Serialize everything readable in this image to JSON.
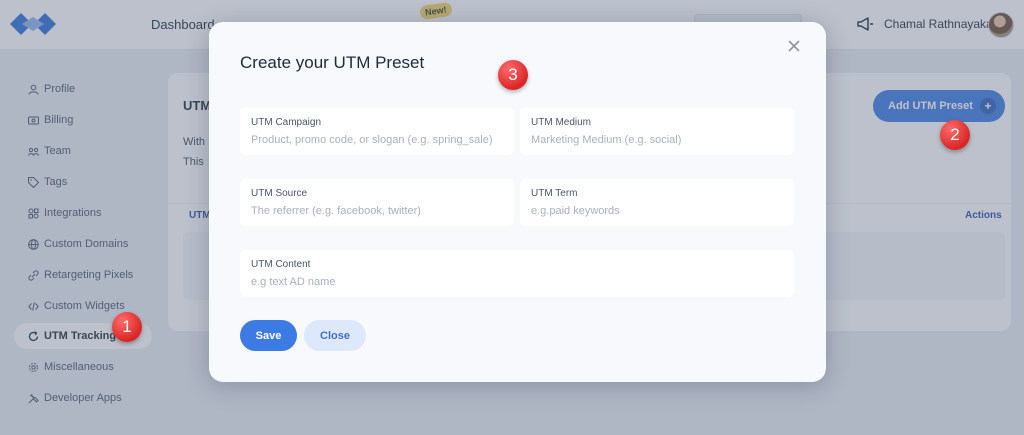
{
  "nav": {
    "items": [
      "Dashboard"
    ],
    "new_badge": "New!",
    "user_name": "Chamal Rathnayaka"
  },
  "sidebar": {
    "items": [
      {
        "label": "Profile",
        "icon": "user-icon"
      },
      {
        "label": "Billing",
        "icon": "billing-icon"
      },
      {
        "label": "Team",
        "icon": "team-icon"
      },
      {
        "label": "Tags",
        "icon": "tag-icon"
      },
      {
        "label": "Integrations",
        "icon": "integrations-icon"
      },
      {
        "label": "Custom Domains",
        "icon": "globe-icon"
      },
      {
        "label": "Retargeting Pixels",
        "icon": "pixel-icon"
      },
      {
        "label": "Custom Widgets",
        "icon": "code-icon"
      },
      {
        "label": "UTM Tracking",
        "icon": "refresh-icon",
        "active": true
      },
      {
        "label": "Miscellaneous",
        "icon": "gear-icon"
      },
      {
        "label": "Developer Apps",
        "icon": "tools-icon"
      }
    ]
  },
  "content": {
    "title": "UTM",
    "line1": "With",
    "line2": "This",
    "add_button": "Add UTM Preset",
    "table_col_first": "UTM",
    "table_col_actions": "Actions"
  },
  "modal": {
    "title": "Create your UTM Preset",
    "fields": [
      {
        "label": "UTM Campaign",
        "placeholder": "Product, promo code, or slogan (e.g. spring_sale)",
        "value": ""
      },
      {
        "label": "UTM Medium",
        "placeholder": "Marketing Medium (e.g. social)",
        "value": ""
      },
      {
        "label": "UTM Source",
        "placeholder": "The referrer (e.g. facebook, twitter)",
        "value": ""
      },
      {
        "label": "UTM Term",
        "placeholder": "e.g.paid keywords",
        "value": ""
      },
      {
        "label": "UTM Content",
        "placeholder": "e.g text AD name",
        "value": ""
      }
    ],
    "save_label": "Save",
    "close_label": "Close"
  },
  "markers": [
    "1",
    "2",
    "3"
  ],
  "colors": {
    "primary": "#3b7be3",
    "marker_red": "#d92626",
    "overlay": "#5f6c82"
  }
}
